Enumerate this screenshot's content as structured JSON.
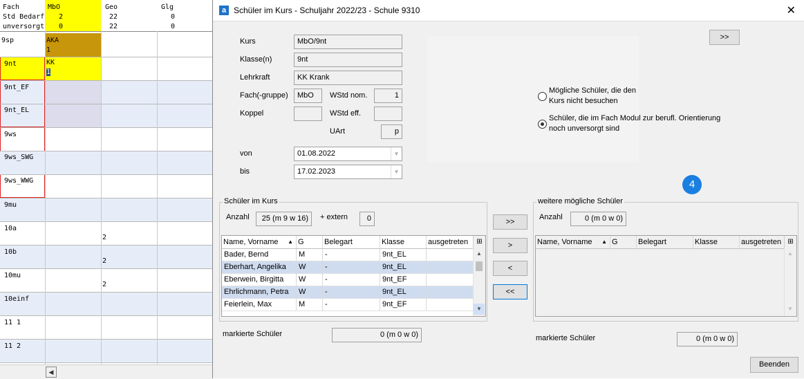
{
  "grid": {
    "header_labels": [
      "Fach",
      "Std Bedarf",
      "unversorgt"
    ],
    "columns": [
      {
        "name": "MbO",
        "std": "2",
        "unversorgt": "0"
      },
      {
        "name": "Geo",
        "std": "22",
        "unversorgt": "22"
      },
      {
        "name": "Glg",
        "std": "0",
        "unversorgt": "0"
      }
    ],
    "rows": [
      "9sp",
      "9nt",
      "9nt_EF",
      "9nt_EL",
      "9ws",
      "9ws_SWG",
      "9ws_WWG",
      "9mu",
      "10a",
      "10b",
      "10mu",
      "10einf",
      "11 1",
      "11 2"
    ],
    "cell_9sp_text": "AKA",
    "cell_9sp_num": "1",
    "cell_9nt_text": "KK",
    "cell_9nt_num": "1",
    "geo_10a": "2",
    "geo_10b": "2",
    "geo_10mu": "2"
  },
  "dialog": {
    "title": "Schüler im Kurs - Schuljahr 2022/23 - Schule 9310",
    "close_glyph": "✕",
    "app_icon": "a",
    "top_button": ">>",
    "labels": {
      "kurs": "Kurs",
      "klasse": "Klasse(n)",
      "lehrkraft": "Lehrkraft",
      "fach": "Fach(-gruppe)",
      "wstd_nom": "WStd nom.",
      "koppel": "Koppel",
      "wstd_eff": "WStd eff.",
      "uart": "UArt",
      "von": "von",
      "bis": "bis"
    },
    "values": {
      "kurs": "MbO/9nt",
      "klasse": "9nt",
      "lehrkraft": "KK Krank",
      "fach": "MbO",
      "wstd_nom": "1",
      "koppel": "",
      "wstd_eff": "",
      "uart": "p",
      "von": "01.08.2022",
      "bis": "17.02.2023"
    },
    "radio1": "Mögliche Schüler, die den Kurs nicht besuchen",
    "radio2": "Schüler, die im Fach Modul zur berufl. Orientierung noch unversorgt sind",
    "badge": "4",
    "left_group": {
      "title": "Schüler im Kurs",
      "anzahl_label": "Anzahl",
      "anzahl_value": "25 (m 9 w 16)",
      "extern_label": "+  extern",
      "extern_value": "0",
      "columns": [
        "Name, Vorname",
        "G",
        "Belegart",
        "Klasse",
        "ausgetreten"
      ],
      "rows": [
        {
          "name": "Bader, Bernd",
          "g": "M",
          "beleg": "-",
          "klasse": "9nt_EL",
          "aus": ""
        },
        {
          "name": "Eberhart, Angelika",
          "g": "W",
          "beleg": "-",
          "klasse": "9nt_EL",
          "aus": ""
        },
        {
          "name": "Eberwein, Birgitta",
          "g": "W",
          "beleg": "-",
          "klasse": "9nt_EF",
          "aus": ""
        },
        {
          "name": "Ehrlichmann, Petra",
          "g": "W",
          "beleg": "-",
          "klasse": "9nt_EL",
          "aus": ""
        },
        {
          "name": "Feierlein, Max",
          "g": "M",
          "beleg": "-",
          "klasse": "9nt_EF",
          "aus": ""
        }
      ],
      "markiert_label": "markierte Schüler",
      "markiert_value": "0 (m 0 w 0)"
    },
    "transfer": [
      ">>",
      ">",
      "<",
      "<<"
    ],
    "right_group": {
      "title": "weitere mögliche Schüler",
      "anzahl_label": "Anzahl",
      "anzahl_value": "0 (m 0 w 0)",
      "columns": [
        "Name, Vorname",
        "G",
        "Belegart",
        "Klasse",
        "ausgetreten"
      ],
      "markiert_label": "markierte Schüler",
      "markiert_value": "0 (m 0 w 0)"
    },
    "beenden": "Beenden"
  }
}
